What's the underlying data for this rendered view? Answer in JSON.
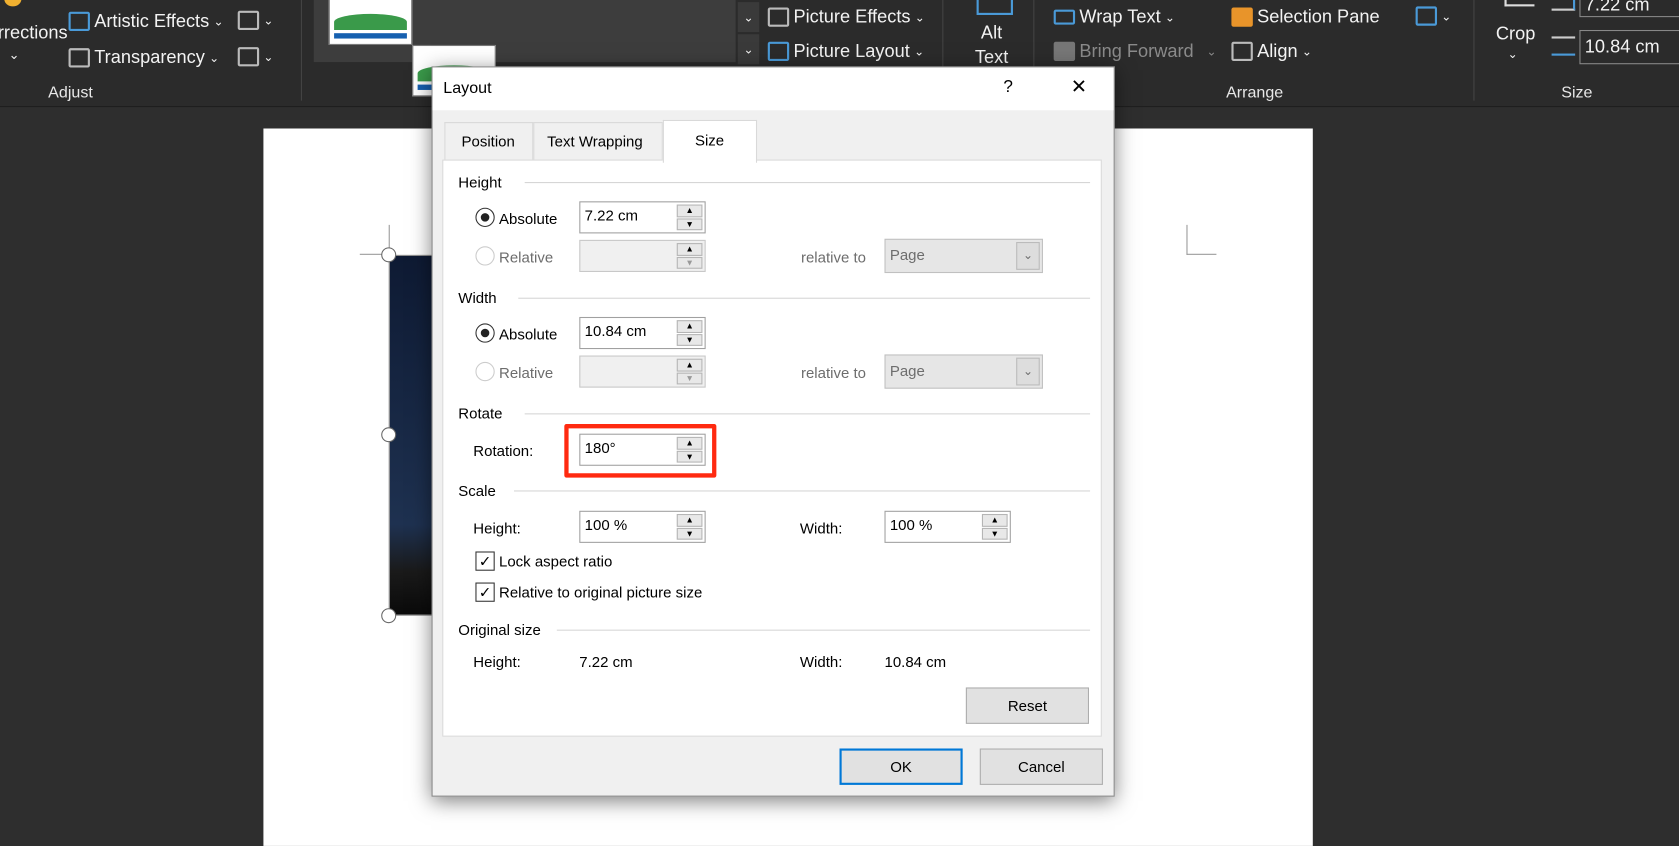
{
  "ribbon": {
    "corrections_label": "rrections",
    "artistic_effects": "Artistic Effects",
    "transparency": "Transparency",
    "adjust_group": "Adjust",
    "picture_effects": "Picture Effects",
    "picture_layout": "Picture Layout",
    "alt_text_1": "Alt",
    "alt_text_2": "Text",
    "wrap_text": "Wrap Text",
    "bring_forward": "Bring Forward",
    "selection_pane": "Selection Pane",
    "align": "Align",
    "arrange_group": "Arrange",
    "crop": "Crop",
    "height_value": "7.22 cm",
    "width_value": "10.84 cm",
    "size_group": "Size"
  },
  "dialog": {
    "title": "Layout",
    "help": "?",
    "close": "✕",
    "tabs": [
      {
        "label": "Position",
        "active": false
      },
      {
        "label": "Text Wrapping",
        "active": false
      },
      {
        "label": "Size",
        "active": true
      }
    ],
    "height": {
      "section": "Height",
      "absolute_label": "Absolute",
      "absolute_value": "7.22 cm",
      "relative_label": "Relative",
      "relative_value": "",
      "relative_to_label": "relative to",
      "relative_to_value": "Page"
    },
    "width": {
      "section": "Width",
      "absolute_label": "Absolute",
      "absolute_value": "10.84 cm",
      "relative_label": "Relative",
      "relative_value": "",
      "relative_to_label": "relative to",
      "relative_to_value": "Page"
    },
    "rotate": {
      "section": "Rotate",
      "rotation_label": "Rotation:",
      "rotation_value": "180°",
      "highlight_color": "#ff2a10"
    },
    "scale": {
      "section": "Scale",
      "height_label": "Height:",
      "height_value": "100 %",
      "width_label": "Width:",
      "width_value": "100 %",
      "lock_aspect": "Lock aspect ratio",
      "lock_aspect_checked": true,
      "relative_original": "Relative to original picture size",
      "relative_original_checked": true
    },
    "original": {
      "section": "Original size",
      "height_label": "Height:",
      "height_value": "7.22 cm",
      "width_label": "Width:",
      "width_value": "10.84 cm"
    },
    "reset": "Reset",
    "ok": "OK",
    "cancel": "Cancel"
  }
}
